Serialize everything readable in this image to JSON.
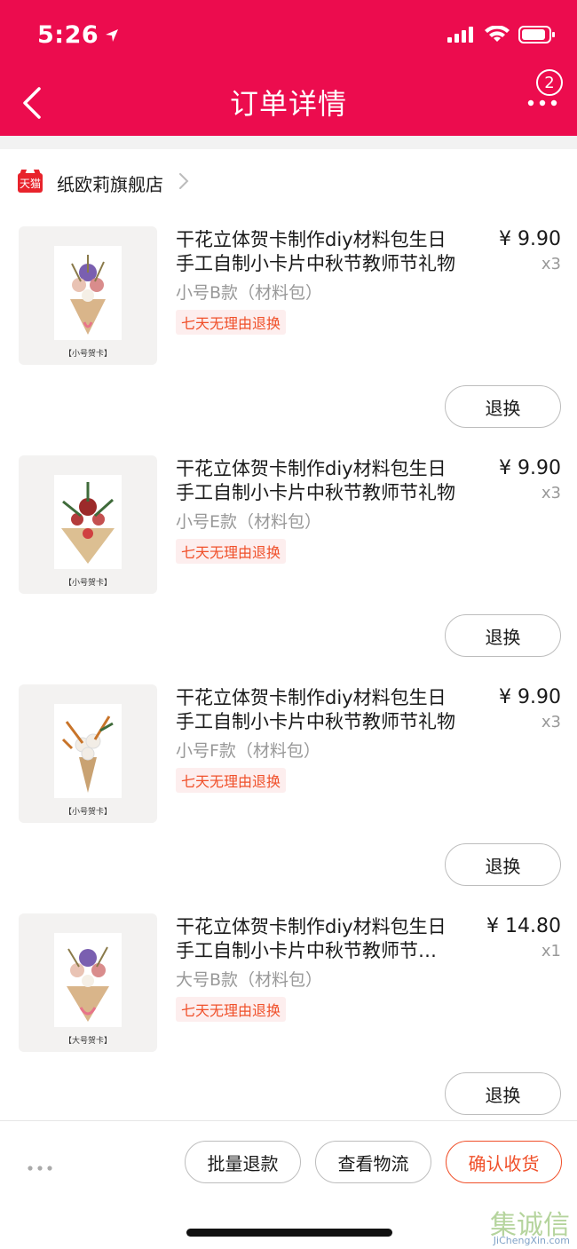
{
  "status_bar": {
    "time": "5:26"
  },
  "nav": {
    "title": "订单详情",
    "badge_count": "2"
  },
  "shop": {
    "logo_text": "天猫",
    "name": "纸欧莉旗舰店"
  },
  "items": [
    {
      "title_line1": "干花立体贺卡制作diy材料包生日",
      "title_line2": "手工自制小卡片中秋节教师节礼物",
      "spec": "小号B款（材料包）",
      "tag": "七天无理由退换",
      "price": "¥ 9.90",
      "qty": "x3",
      "thumb_label": "【小号贺卡】",
      "button": "退换",
      "accent": "#7a5fb0"
    },
    {
      "title_line1": "干花立体贺卡制作diy材料包生日",
      "title_line2": "手工自制小卡片中秋节教师节礼物",
      "spec": "小号E款（材料包）",
      "tag": "七天无理由退换",
      "price": "¥ 9.90",
      "qty": "x3",
      "thumb_label": "【小号贺卡】",
      "button": "退换",
      "accent": "#9c2a2a"
    },
    {
      "title_line1": "干花立体贺卡制作diy材料包生日",
      "title_line2": "手工自制小卡片中秋节教师节礼物",
      "spec": "小号F款（材料包）",
      "tag": "七天无理由退换",
      "price": "¥ 9.90",
      "qty": "x3",
      "thumb_label": "【小号贺卡】",
      "button": "退换",
      "accent": "#c8742a"
    },
    {
      "title_line1": "干花立体贺卡制作diy材料包生日",
      "title_line2": "手工自制小卡片中秋节教师节…",
      "spec": "大号B款（材料包）",
      "tag": "七天无理由退换",
      "price": "¥ 14.80",
      "qty": "x1",
      "thumb_label": "【大号贺卡】",
      "button": "退换",
      "accent": "#7a5fb0"
    }
  ],
  "bottom": {
    "batch_refund": "批量退款",
    "view_logistics": "查看物流",
    "confirm_receipt": "确认收货"
  },
  "watermark": {
    "text": "集诚信",
    "sub": "JiChengXin.com"
  },
  "colors": {
    "brand": "#ec0c4e",
    "accent_orange": "#f0502a"
  }
}
